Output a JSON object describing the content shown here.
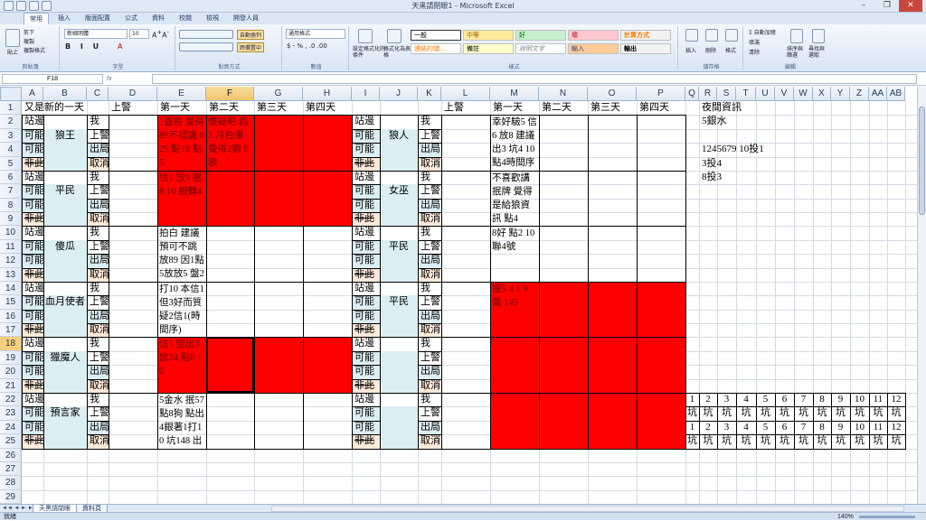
{
  "window": {
    "title": "天黑請閉眼1 - Microsoft Excel"
  },
  "ribbon_tabs": [
    "常用",
    "插入",
    "版面配置",
    "公式",
    "資料",
    "校閱",
    "檢視",
    "開發人員"
  ],
  "ribbon": {
    "paste": "貼上",
    "cut": "剪下",
    "copy": "複製",
    "format_painter": "複製格式",
    "clipboard": "剪貼簿",
    "font_name": "新細明體",
    "font_size": "10",
    "font": "字型",
    "wrap_text": "自動換列",
    "merge_center": "跨欄置中",
    "alignment": "對齊方式",
    "number_format": "通用格式",
    "number": "數值",
    "conditional_format": "設定格式化的條件",
    "format_as_table": "格式化為表格",
    "styles": "樣式",
    "style_general": "一般",
    "style_neutral": "中等",
    "style_good": "好",
    "style_bad": "壞",
    "style_calc": "計算方式",
    "style_linked": "連結的儲...",
    "style_note": "備註",
    "style_explan": "說明文字",
    "style_input": "輸入",
    "style_output": "輸出",
    "insert": "插入",
    "delete": "刪除",
    "format": "格式",
    "cells": "儲存格",
    "autosum": "自動加總",
    "fill": "填滿",
    "clear": "清除",
    "sort_filter": "排序與篩選",
    "find_select": "尋找與選取",
    "editing": "編輯"
  },
  "formula_bar": {
    "name_box": "F18",
    "fx": "fx",
    "formula": ""
  },
  "columns": [
    "A",
    "B",
    "C",
    "D",
    "E",
    "F",
    "G",
    "H",
    "I",
    "J",
    "K",
    "L",
    "M",
    "N",
    "O",
    "P",
    "Q",
    "R",
    "S",
    "T",
    "U",
    "V",
    "W",
    "X",
    "Y",
    "Z",
    "AA",
    "AB"
  ],
  "selected_col": "F",
  "selected_row": "18",
  "rows": [
    "1",
    "2",
    "3",
    "4",
    "5",
    "6",
    "7",
    "8",
    "9",
    "10",
    "11",
    "12",
    "13",
    "14",
    "15",
    "16",
    "17",
    "18",
    "19",
    "20",
    "21",
    "22",
    "23",
    "24",
    "25",
    "26",
    "27",
    "28",
    "29"
  ],
  "header_row": {
    "title": "又是新的一天",
    "left_on_police": "上警",
    "left_day1": "第一天",
    "left_day2": "第二天",
    "left_day3": "第三天",
    "left_day4": "第四天",
    "right_on_police": "上警",
    "right_day1": "第一天",
    "right_day2": "第二天",
    "right_day3": "第三天",
    "right_day4": "第四天"
  },
  "player_labels": {
    "side": "站邊",
    "possible": "可能",
    "impossible": "非此",
    "me": "我",
    "on_police": "上警",
    "out": "出局",
    "cancel": "取消"
  },
  "left_roles": [
    "狼王",
    "平民",
    "傻瓜",
    "血月使者",
    "獵魔人",
    "預言家"
  ],
  "right_roles": [
    "狼人",
    "女巫",
    "平民",
    "平民",
    "",
    ""
  ],
  "notes": {
    "e2": "1查殺 覺得89不認識 829 點10 點5",
    "f2": "懷疑吧 跑 3 月白爆 覺得2狼 9狼",
    "e6": "信1 放9 抿8 10 銀轉4",
    "e10": "拍白 建議預可不跳 放89 因1點 5放放5 盤2",
    "e14": "打10 本信1 但3好而質疑2信1(時 間序)",
    "e18": "信1 盟出3 放24 點8 10",
    "e22": "5金水 抿57 點8狗 點出 4銀著1打10 坑148 出8",
    "m2": "幸好驗5 信6 放8 建議 出3 坑4 10 點4時間序",
    "m6": "不喜歡講 抿牌 覺得 是給狼資 訊 點4",
    "m10": "8好 點2 10 聯4號",
    "m14": "抿5 4 1 9 覺 145"
  },
  "night_info": {
    "title": "夜間資訊",
    "line1": "5銀水",
    "line2": "1245679 10投1",
    "line3": "3投4",
    "line4": "8投3"
  },
  "pit_numbers": [
    "1",
    "2",
    "3",
    "4",
    "5",
    "6",
    "7",
    "8",
    "9",
    "10",
    "11",
    "12"
  ],
  "pit_label": "坑",
  "sheet_tabs": [
    "天黑請閉眼",
    "資料頁"
  ],
  "status": {
    "ready": "就緒",
    "zoom": "140%"
  },
  "colors": {
    "red": "#ff0000",
    "blue_fill": "#dbeef4",
    "peach_fill": "#fde9d9"
  }
}
